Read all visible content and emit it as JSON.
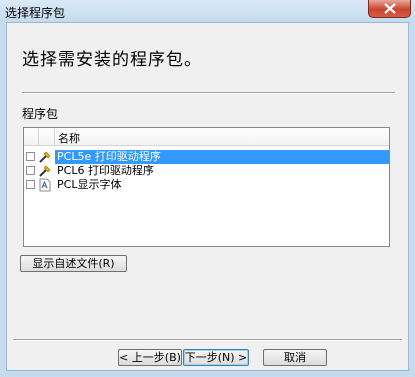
{
  "window": {
    "title": "选择程序包"
  },
  "page": {
    "heading": "选择需安装的程序包。"
  },
  "packages": {
    "group_label": "程序包",
    "column_header": "名称",
    "items": [
      {
        "label": "PCL5e 打印驱动程序",
        "checked": false,
        "selected": true,
        "icon": "driver-icon"
      },
      {
        "label": "PCL6 打印驱动程序",
        "checked": false,
        "selected": false,
        "icon": "driver-icon"
      },
      {
        "label": "PCL显示字体",
        "checked": false,
        "selected": false,
        "icon": "font-file-icon"
      }
    ]
  },
  "buttons": {
    "show_readme": "显示自述文件(R)",
    "back": "< 上一步(B)",
    "next": "下一步(N) >",
    "cancel": "取消"
  },
  "colors": {
    "selection": "#3399ff",
    "client_bg": "#f0f0f0",
    "frame": "#c6dcee"
  }
}
